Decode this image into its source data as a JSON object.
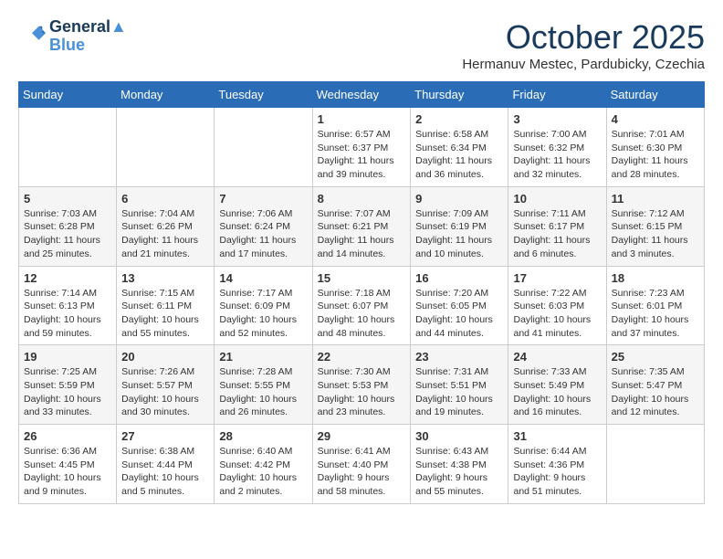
{
  "header": {
    "logo_line1": "General",
    "logo_line2": "Blue",
    "month": "October 2025",
    "location": "Hermanuv Mestec, Pardubicky, Czechia"
  },
  "days_of_week": [
    "Sunday",
    "Monday",
    "Tuesday",
    "Wednesday",
    "Thursday",
    "Friday",
    "Saturday"
  ],
  "weeks": [
    [
      {
        "day": "",
        "detail": ""
      },
      {
        "day": "",
        "detail": ""
      },
      {
        "day": "",
        "detail": ""
      },
      {
        "day": "1",
        "detail": "Sunrise: 6:57 AM\nSunset: 6:37 PM\nDaylight: 11 hours\nand 39 minutes."
      },
      {
        "day": "2",
        "detail": "Sunrise: 6:58 AM\nSunset: 6:34 PM\nDaylight: 11 hours\nand 36 minutes."
      },
      {
        "day": "3",
        "detail": "Sunrise: 7:00 AM\nSunset: 6:32 PM\nDaylight: 11 hours\nand 32 minutes."
      },
      {
        "day": "4",
        "detail": "Sunrise: 7:01 AM\nSunset: 6:30 PM\nDaylight: 11 hours\nand 28 minutes."
      }
    ],
    [
      {
        "day": "5",
        "detail": "Sunrise: 7:03 AM\nSunset: 6:28 PM\nDaylight: 11 hours\nand 25 minutes."
      },
      {
        "day": "6",
        "detail": "Sunrise: 7:04 AM\nSunset: 6:26 PM\nDaylight: 11 hours\nand 21 minutes."
      },
      {
        "day": "7",
        "detail": "Sunrise: 7:06 AM\nSunset: 6:24 PM\nDaylight: 11 hours\nand 17 minutes."
      },
      {
        "day": "8",
        "detail": "Sunrise: 7:07 AM\nSunset: 6:21 PM\nDaylight: 11 hours\nand 14 minutes."
      },
      {
        "day": "9",
        "detail": "Sunrise: 7:09 AM\nSunset: 6:19 PM\nDaylight: 11 hours\nand 10 minutes."
      },
      {
        "day": "10",
        "detail": "Sunrise: 7:11 AM\nSunset: 6:17 PM\nDaylight: 11 hours\nand 6 minutes."
      },
      {
        "day": "11",
        "detail": "Sunrise: 7:12 AM\nSunset: 6:15 PM\nDaylight: 11 hours\nand 3 minutes."
      }
    ],
    [
      {
        "day": "12",
        "detail": "Sunrise: 7:14 AM\nSunset: 6:13 PM\nDaylight: 10 hours\nand 59 minutes."
      },
      {
        "day": "13",
        "detail": "Sunrise: 7:15 AM\nSunset: 6:11 PM\nDaylight: 10 hours\nand 55 minutes."
      },
      {
        "day": "14",
        "detail": "Sunrise: 7:17 AM\nSunset: 6:09 PM\nDaylight: 10 hours\nand 52 minutes."
      },
      {
        "day": "15",
        "detail": "Sunrise: 7:18 AM\nSunset: 6:07 PM\nDaylight: 10 hours\nand 48 minutes."
      },
      {
        "day": "16",
        "detail": "Sunrise: 7:20 AM\nSunset: 6:05 PM\nDaylight: 10 hours\nand 44 minutes."
      },
      {
        "day": "17",
        "detail": "Sunrise: 7:22 AM\nSunset: 6:03 PM\nDaylight: 10 hours\nand 41 minutes."
      },
      {
        "day": "18",
        "detail": "Sunrise: 7:23 AM\nSunset: 6:01 PM\nDaylight: 10 hours\nand 37 minutes."
      }
    ],
    [
      {
        "day": "19",
        "detail": "Sunrise: 7:25 AM\nSunset: 5:59 PM\nDaylight: 10 hours\nand 33 minutes."
      },
      {
        "day": "20",
        "detail": "Sunrise: 7:26 AM\nSunset: 5:57 PM\nDaylight: 10 hours\nand 30 minutes."
      },
      {
        "day": "21",
        "detail": "Sunrise: 7:28 AM\nSunset: 5:55 PM\nDaylight: 10 hours\nand 26 minutes."
      },
      {
        "day": "22",
        "detail": "Sunrise: 7:30 AM\nSunset: 5:53 PM\nDaylight: 10 hours\nand 23 minutes."
      },
      {
        "day": "23",
        "detail": "Sunrise: 7:31 AM\nSunset: 5:51 PM\nDaylight: 10 hours\nand 19 minutes."
      },
      {
        "day": "24",
        "detail": "Sunrise: 7:33 AM\nSunset: 5:49 PM\nDaylight: 10 hours\nand 16 minutes."
      },
      {
        "day": "25",
        "detail": "Sunrise: 7:35 AM\nSunset: 5:47 PM\nDaylight: 10 hours\nand 12 minutes."
      }
    ],
    [
      {
        "day": "26",
        "detail": "Sunrise: 6:36 AM\nSunset: 4:45 PM\nDaylight: 10 hours\nand 9 minutes."
      },
      {
        "day": "27",
        "detail": "Sunrise: 6:38 AM\nSunset: 4:44 PM\nDaylight: 10 hours\nand 5 minutes."
      },
      {
        "day": "28",
        "detail": "Sunrise: 6:40 AM\nSunset: 4:42 PM\nDaylight: 10 hours\nand 2 minutes."
      },
      {
        "day": "29",
        "detail": "Sunrise: 6:41 AM\nSunset: 4:40 PM\nDaylight: 9 hours\nand 58 minutes."
      },
      {
        "day": "30",
        "detail": "Sunrise: 6:43 AM\nSunset: 4:38 PM\nDaylight: 9 hours\nand 55 minutes."
      },
      {
        "day": "31",
        "detail": "Sunrise: 6:44 AM\nSunset: 4:36 PM\nDaylight: 9 hours\nand 51 minutes."
      },
      {
        "day": "",
        "detail": ""
      }
    ]
  ]
}
